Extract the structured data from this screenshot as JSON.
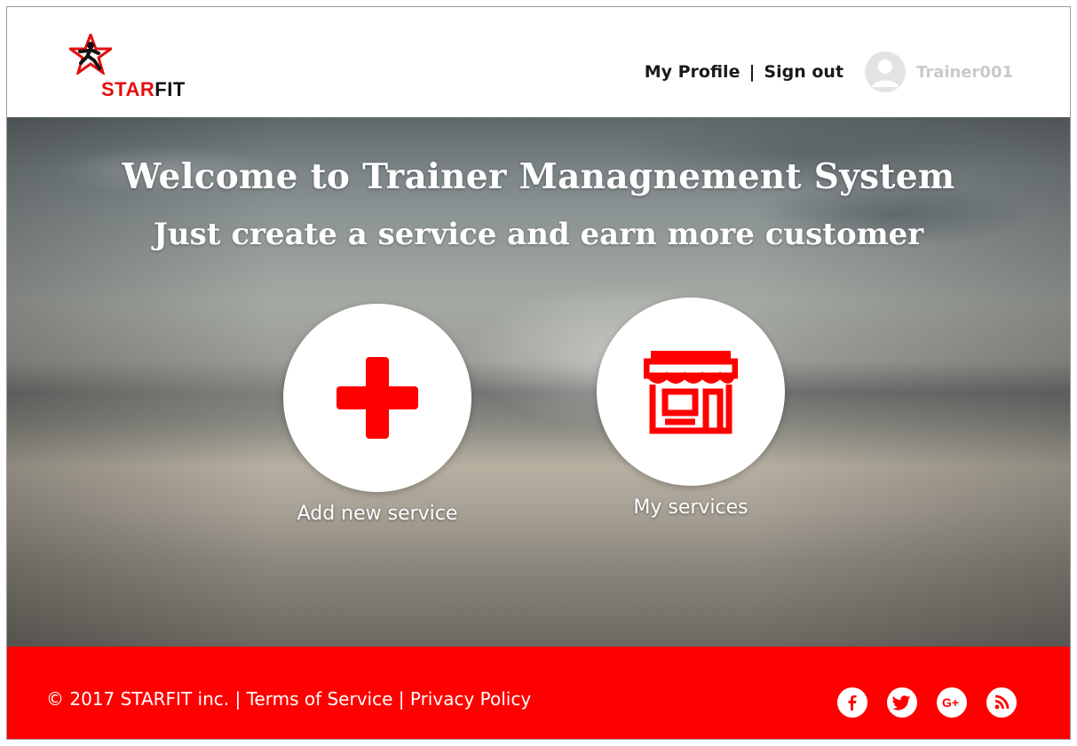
{
  "brand": {
    "logo_part1": "STAR",
    "logo_part2": "FIT"
  },
  "header": {
    "nav": {
      "profile": "My Profile",
      "separator": "|",
      "signout": "Sign out"
    },
    "user": {
      "name": "Trainer001",
      "avatar_icon": "user-avatar-icon"
    }
  },
  "hero": {
    "title": "Welcome to Trainer Managnement System",
    "subtitle": "Just create a service and earn more customer",
    "actions": [
      {
        "label": "Add new service",
        "icon": "plus-icon"
      },
      {
        "label": "My services",
        "icon": "storefront-icon"
      }
    ]
  },
  "footer": {
    "copyright": "© 2017 STARFIT inc.",
    "sep": "|",
    "terms": "Terms of Service",
    "privacy": "Privacy Policy",
    "social": [
      "facebook-icon",
      "twitter-icon",
      "google-plus-icon",
      "rss-icon"
    ]
  },
  "colors": {
    "brand_red": "#ff0000",
    "logo_red": "#e30d0d",
    "white": "#ffffff",
    "username_gray": "#c9c9c9"
  }
}
